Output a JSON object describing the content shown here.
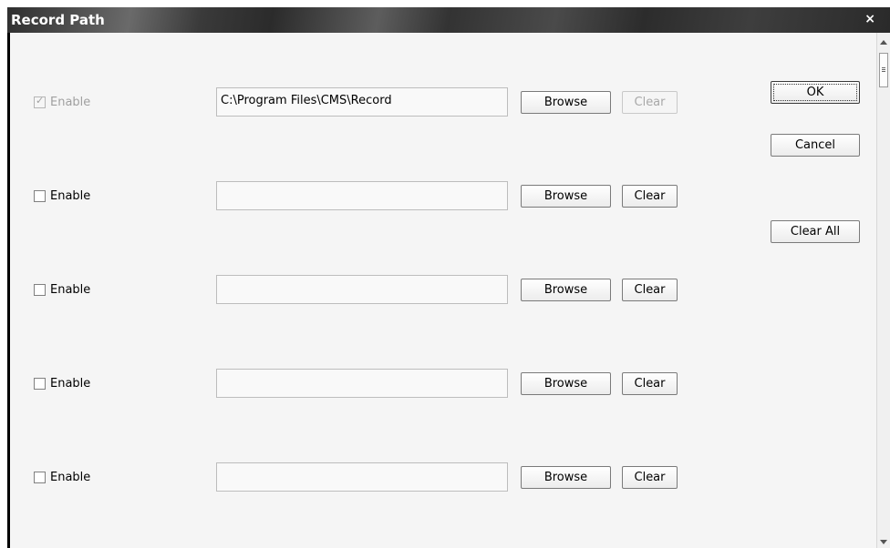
{
  "window": {
    "title": "Record Path",
    "close_glyph": "×"
  },
  "rows": [
    {
      "enable_label": "Enable",
      "checked": true,
      "disabled": true,
      "path": "C:\\Program Files\\CMS\\Record",
      "browse_label": "Browse",
      "clear_label": "Clear",
      "clear_disabled": true
    },
    {
      "enable_label": "Enable",
      "checked": false,
      "disabled": false,
      "path": "",
      "browse_label": "Browse",
      "clear_label": "Clear",
      "clear_disabled": false
    },
    {
      "enable_label": "Enable",
      "checked": false,
      "disabled": false,
      "path": "",
      "browse_label": "Browse",
      "clear_label": "Clear",
      "clear_disabled": false
    },
    {
      "enable_label": "Enable",
      "checked": false,
      "disabled": false,
      "path": "",
      "browse_label": "Browse",
      "clear_label": "Clear",
      "clear_disabled": false
    },
    {
      "enable_label": "Enable",
      "checked": false,
      "disabled": false,
      "path": "",
      "browse_label": "Browse",
      "clear_label": "Clear",
      "clear_disabled": false
    }
  ],
  "actions": {
    "ok_label": "OK",
    "cancel_label": "Cancel",
    "clear_all_label": "Clear All"
  },
  "icons": {
    "checkmark": "✓"
  }
}
